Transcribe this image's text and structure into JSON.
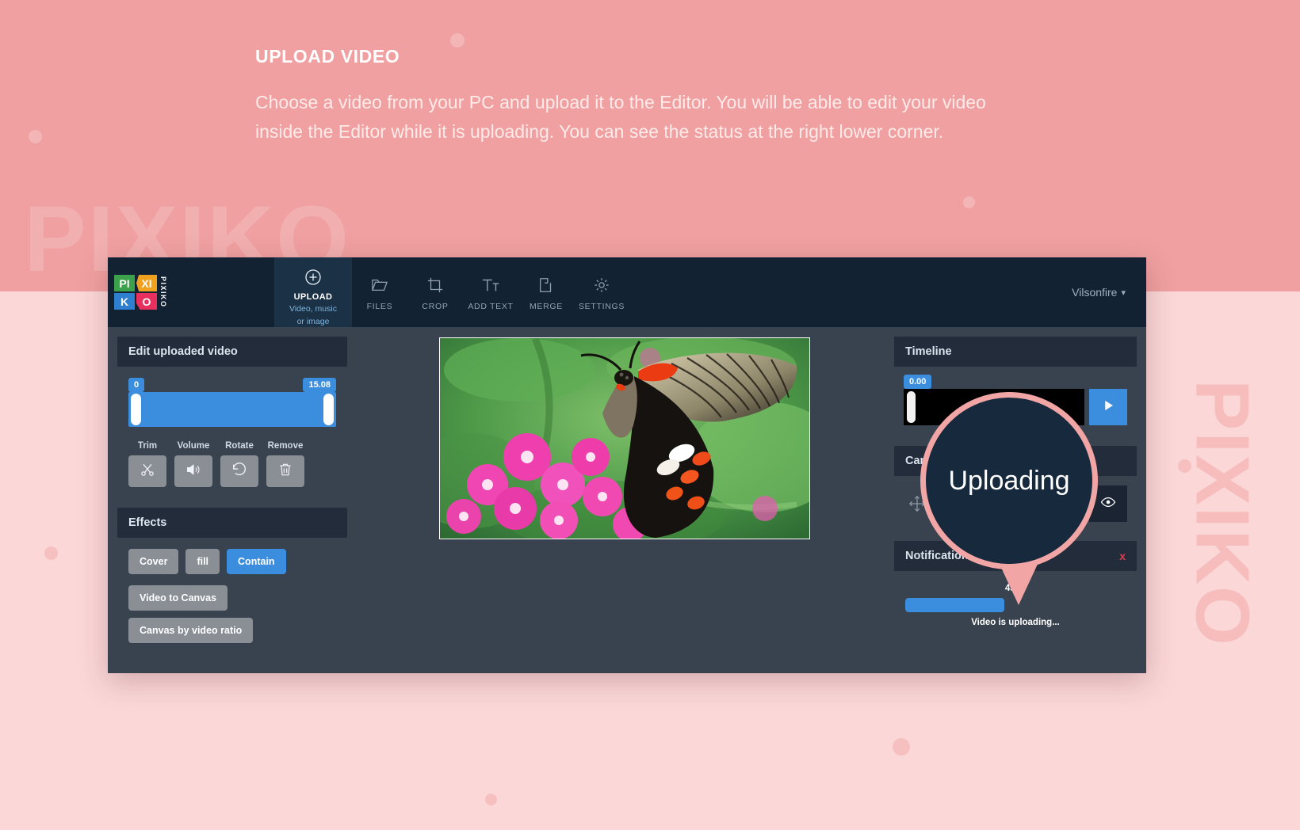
{
  "intro": {
    "title": "UPLOAD VIDEO",
    "body": "Choose a video from your PC and upload it to the Editor. You will be able to edit your video inside the Editor while it is uploading. You can see the status at the right lower corner."
  },
  "watermark": {
    "left": "PIXIKO",
    "right": "PIXIKO"
  },
  "logo": {
    "cells": [
      "PI",
      "XI",
      "K",
      "O"
    ],
    "vertical_text": "PIXIKO",
    "colors": {
      "pi": "#3ba14a",
      "xi": "#f0a11e",
      "k": "#2f7fd0",
      "o": "#e8305f"
    }
  },
  "topbar": {
    "upload": {
      "label": "UPLOAD",
      "sublabel_line1": "Video, music",
      "sublabel_line2": "or image",
      "icon": "plus-circle-icon"
    },
    "items": [
      {
        "label": "FILES",
        "icon": "folder-icon"
      },
      {
        "label": "CROP",
        "icon": "crop-icon"
      },
      {
        "label": "ADD TEXT",
        "icon": "text-icon"
      },
      {
        "label": "MERGE",
        "icon": "merge-icon"
      },
      {
        "label": "SETTINGS",
        "icon": "gear-icon"
      }
    ],
    "user": {
      "name": "Vilsonfire",
      "caret": "▾"
    }
  },
  "edit_panel": {
    "title": "Edit uploaded video",
    "range": {
      "start_label": "0",
      "end_label": "15.08",
      "start_value": 0,
      "end_value": 15.08
    }
  },
  "tools": [
    {
      "label": "Trim",
      "icon": "scissors-icon"
    },
    {
      "label": "Volume",
      "icon": "speaker-icon"
    },
    {
      "label": "Rotate",
      "icon": "rotate-ccw-icon"
    },
    {
      "label": "Remove",
      "icon": "trash-icon"
    }
  ],
  "effects": {
    "title": "Effects",
    "fit_modes": [
      {
        "label": "Cover",
        "active": false
      },
      {
        "label": "fill",
        "active": false
      },
      {
        "label": "Contain",
        "active": true
      }
    ],
    "actions": [
      {
        "label": "Video to Canvas"
      },
      {
        "label": "Canvas by video ratio"
      }
    ]
  },
  "timeline": {
    "title": "Timeline",
    "time_badge": "0.00",
    "play_icon": "play-icon"
  },
  "canvas_panel": {
    "title": "Canvas",
    "move_icon": "move-arrows-icon",
    "eye_icon": "eye-icon"
  },
  "notification": {
    "title": "Notification",
    "close_label": "x",
    "percent_label": "45 %",
    "percent_value": 45,
    "status_text": "Video is uploading..."
  },
  "callout": {
    "text": "Uploading",
    "ring_color": "#f2a5a5",
    "fill_color": "#17293c"
  },
  "preview": {
    "alt": "butterfly-on-pink-pentas-flowers"
  }
}
